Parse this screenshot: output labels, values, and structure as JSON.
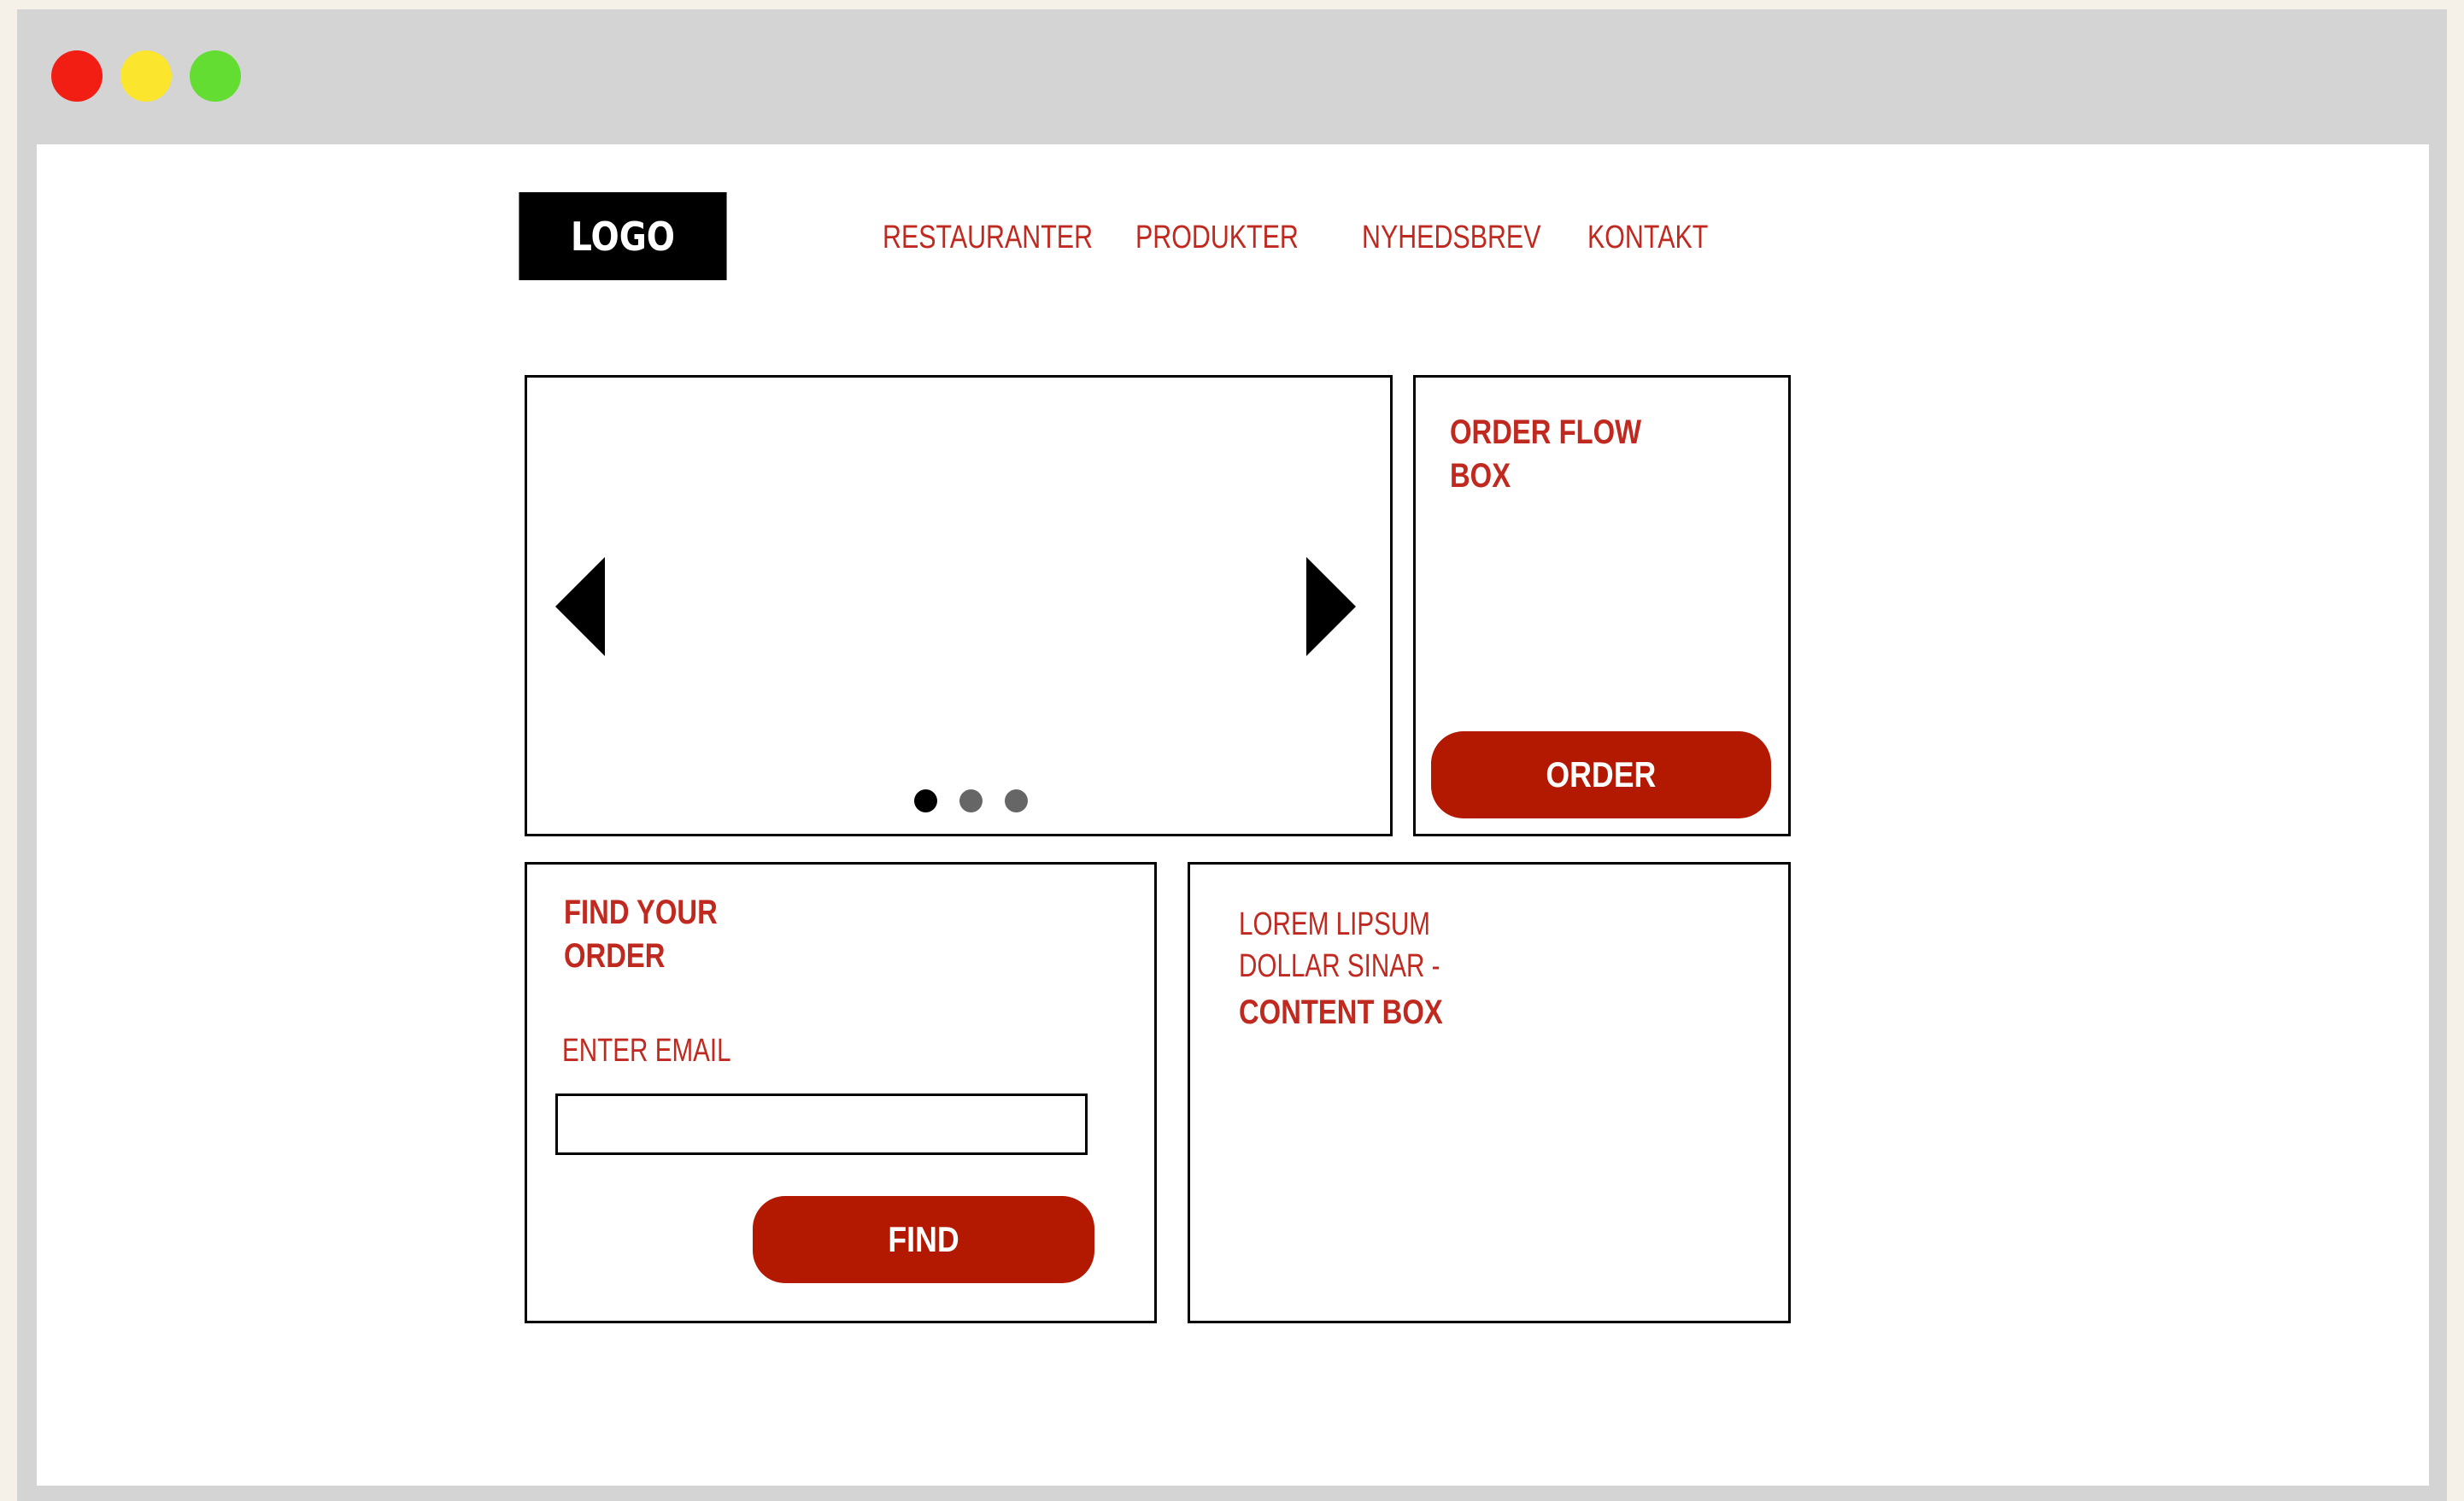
{
  "colors": {
    "accent": "#c0291f",
    "button": "#b31800",
    "traffic_red": "#f21d13",
    "traffic_yellow": "#fbe52d",
    "traffic_green": "#64dd33",
    "slide_dot_active": "#000000",
    "slide_dot_inactive": "#666666"
  },
  "header": {
    "logo": "LOGO",
    "nav": [
      "RESTAURANTER",
      "PRODUKTER",
      "NYHEDSBREV",
      "KONTAKT"
    ]
  },
  "slider": {
    "slide_count": 3,
    "active_slide": 1
  },
  "order_box": {
    "title_line1": "ORDER FLOW",
    "title_line2": "BOX",
    "button_label": "ORDER"
  },
  "find_box": {
    "title_line1": "FIND YOUR",
    "title_line2": "ORDER",
    "email_label": "ENTER EMAIL",
    "email_value": "",
    "button_label": "FIND"
  },
  "content_box": {
    "line1": "LOREM LIPSUM",
    "line2": "DOLLAR SINAR -",
    "line3": "CONTENT BOX"
  }
}
